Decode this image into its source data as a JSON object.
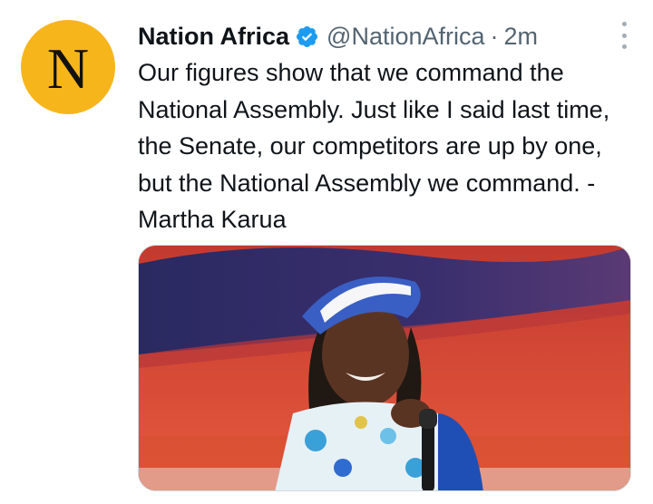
{
  "author": {
    "display_name": "Nation Africa",
    "handle": "@NationAfrica",
    "separator": "·",
    "time": "2m",
    "avatar_letter": "N",
    "avatar_color": "#f7b51c",
    "verified_color": "#1d9bf0"
  },
  "tweet": {
    "text": "Our figures show that we command the National Assembly. Just like I said last time, the Senate, our competitors are up by one, but the National Assembly we command. - Martha Karua"
  },
  "icons": {
    "verified": "verified-badge-icon",
    "more": "more-options-icon"
  },
  "media": {
    "subject": "photo-of-woman-speaking-into-microphone"
  }
}
